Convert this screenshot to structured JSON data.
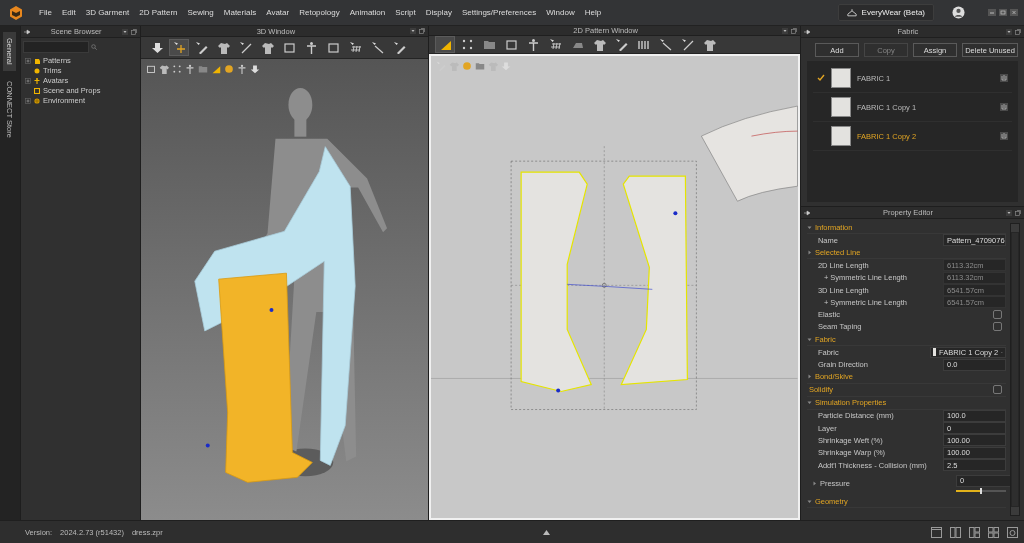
{
  "menu_bar": {
    "items": [
      "File",
      "Edit",
      "3D Garment",
      "2D Pattern",
      "Sewing",
      "Materials",
      "Avatar",
      "Retopology",
      "Animation",
      "Script",
      "Display",
      "Settings/Preferences",
      "Window",
      "Help"
    ],
    "product_button": "EveryWear (Beta)"
  },
  "side_tabs": [
    {
      "label": "General",
      "selected": true
    },
    {
      "label": "CONNECT Store",
      "selected": false
    }
  ],
  "scene_browser": {
    "title": "Scene Browser",
    "items": [
      {
        "label": "Patterns",
        "expanded": false
      },
      {
        "label": "Trims"
      },
      {
        "label": "Avatars",
        "expanded": false
      },
      {
        "label": "Scene and Props"
      },
      {
        "label": "Environment",
        "expanded": false
      }
    ]
  },
  "window_3d": {
    "title": "3D Window"
  },
  "window_2d": {
    "title": "2D Pattern Window"
  },
  "fabric_panel": {
    "title": "Fabric",
    "buttons": [
      {
        "label": "Add",
        "disabled": false
      },
      {
        "label": "Copy",
        "disabled": true
      },
      {
        "label": "Assign",
        "disabled": false
      },
      {
        "label": "Delete Unused",
        "disabled": false
      }
    ],
    "items": [
      {
        "name": "FABRIC 1",
        "checked": true,
        "selected": false
      },
      {
        "name": "FABRIC 1 Copy 1",
        "checked": false,
        "selected": false
      },
      {
        "name": "FABRIC 1 Copy 2",
        "checked": false,
        "selected": true
      }
    ]
  },
  "property_editor": {
    "title": "Property Editor",
    "sections": [
      {
        "title": "Information",
        "kind": "group",
        "expanded": true,
        "rows": [
          {
            "kind": "field",
            "label": "Name",
            "value": "Pattern_4709076",
            "disabled": false
          }
        ]
      },
      {
        "title": "Selected Line",
        "kind": "group",
        "expanded": false,
        "rows": [
          {
            "kind": "field",
            "label": "2D Line Length",
            "value": "6113.32cm",
            "disabled": true,
            "children": [
              {
                "kind": "field",
                "label": "+ Symmetric Line Length",
                "value": "6113.32cm",
                "disabled": true
              }
            ]
          },
          {
            "kind": "field",
            "label": "3D Line Length",
            "value": "6541.57cm",
            "disabled": true,
            "children": [
              {
                "kind": "field",
                "label": "+ Symmetric Line Length",
                "value": "6541.57cm",
                "disabled": true
              }
            ]
          },
          {
            "kind": "checkbox",
            "label": "Elastic",
            "checked": false
          },
          {
            "kind": "checkbox",
            "label": "Seam Taping",
            "checked": false
          }
        ]
      },
      {
        "title": "Fabric",
        "kind": "group",
        "expanded": true,
        "rows": [
          {
            "kind": "select",
            "label": "Fabric",
            "value": "FABRIC 1 Copy 2"
          },
          {
            "kind": "field",
            "label": "Grain Direction",
            "value": "0.0",
            "disabled": false
          }
        ]
      },
      {
        "title": "Bond/Skive",
        "kind": "group",
        "expanded": false
      },
      {
        "title": "Solidify",
        "kind": "checkbox",
        "checked": false
      },
      {
        "title": "Simulation Properties",
        "kind": "group",
        "expanded": true,
        "rows": [
          {
            "kind": "field",
            "label": "Particle Distance (mm)",
            "value": "100.0",
            "disabled": false
          },
          {
            "kind": "field",
            "label": "Layer",
            "value": "0",
            "disabled": false
          },
          {
            "kind": "field",
            "label": "Shrinkage Weft (%)",
            "value": "100.00",
            "disabled": false
          },
          {
            "kind": "field",
            "label": "Shrinkage Warp (%)",
            "value": "100.00",
            "disabled": false
          },
          {
            "kind": "field",
            "label": "Addt'l Thickness - Collision (mm)",
            "value": "2.5",
            "disabled": false
          },
          {
            "kind": "slider",
            "label": "Pressure",
            "expanded": false,
            "value": "0",
            "level": 0.5
          }
        ]
      },
      {
        "title": "Geometry",
        "kind": "group",
        "expanded": true
      }
    ]
  },
  "status_bar": {
    "version_label": "Version:",
    "version": "2024.2.73 (r51432)",
    "file": "dress.zpr"
  }
}
